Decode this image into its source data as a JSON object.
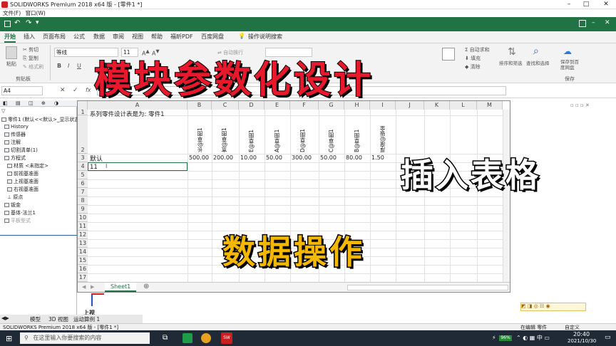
{
  "window": {
    "title": "SOLIDWORKS Premium 2018 x64 版 - [零件1 *]",
    "menu": [
      "文件(F)",
      "窗口(W)"
    ]
  },
  "ribbon": {
    "tabs": [
      "开始",
      "插入",
      "页面布局",
      "公式",
      "数据",
      "审阅",
      "视图",
      "帮助",
      "福昕PDF",
      "百度网盘"
    ],
    "search_label": "操作说明搜索",
    "clipboard": {
      "paste": "粘贴",
      "cut": "剪切",
      "copy": "复制",
      "format_painter": "格式刷",
      "group": "剪贴板"
    },
    "font": {
      "name": "等线",
      "size": "11",
      "bold": "B",
      "italic": "I",
      "underline": "U"
    },
    "align": {
      "wrap": "自动换行"
    },
    "editing": {
      "autosum": "自动求和",
      "fill": "填充",
      "clear": "清除",
      "sort_filter": "排序和筛选",
      "find_select": "查找和选择"
    },
    "save": {
      "label": "保存到百度网盘",
      "group": "保存"
    }
  },
  "formula_bar": {
    "name_box": "A4",
    "fx": "fx"
  },
  "tree": {
    "items": [
      "零件1 (默认<<默认>_显示状态",
      "History",
      "传感器",
      "注解",
      "切割清单(1)",
      "方程式",
      "材质 <未指定>",
      "前视基准面",
      "上视基准面",
      "右视基准面",
      "原点",
      "钣金",
      "基体-法兰1",
      "平板型式"
    ]
  },
  "sheet": {
    "columns": [
      "A",
      "B",
      "C",
      "D",
      "E",
      "F",
      "G",
      "H",
      "I",
      "J",
      "K",
      "L",
      "M"
    ],
    "rows": [
      "1",
      "2",
      "3",
      "4",
      "5",
      "6",
      "7",
      "8",
      "9",
      "10",
      "11",
      "12",
      "13",
      "14",
      "15",
      "16",
      "17"
    ],
    "title": "系列零件设计表是为:  零件1",
    "headers": [
      "长@草图1",
      "宽@草图1",
      "E@草图1",
      "A@草图1",
      "D@草图1",
      "C@草图1",
      "B@草图1",
      "厚度@钣金"
    ],
    "row3_label": "默认",
    "row3_values": [
      "500.00",
      "200.00",
      "10.00",
      "50.00",
      "300.00",
      "50.00",
      "80.00",
      "1.50"
    ],
    "row4_input": "11",
    "sheet_tab": "Sheet1"
  },
  "overlay": {
    "title": "模块参数化设计",
    "insert_table": "插入表格",
    "data_ops": "数据操作"
  },
  "model_tabs": [
    "模型",
    "3D 视图",
    "运动算例 1"
  ],
  "view_label": "上视",
  "status": {
    "editing": "在编辑 零件",
    "custom": "自定义"
  },
  "taskbar": {
    "search_placeholder": "在这里输入你要搜索的内容",
    "time": "20:40",
    "date": "2021/10/30",
    "battery": "96%"
  },
  "colors": {
    "excel_green": "#217346",
    "overlay_red": "#e8192c",
    "overlay_yellow": "#f5b800"
  }
}
